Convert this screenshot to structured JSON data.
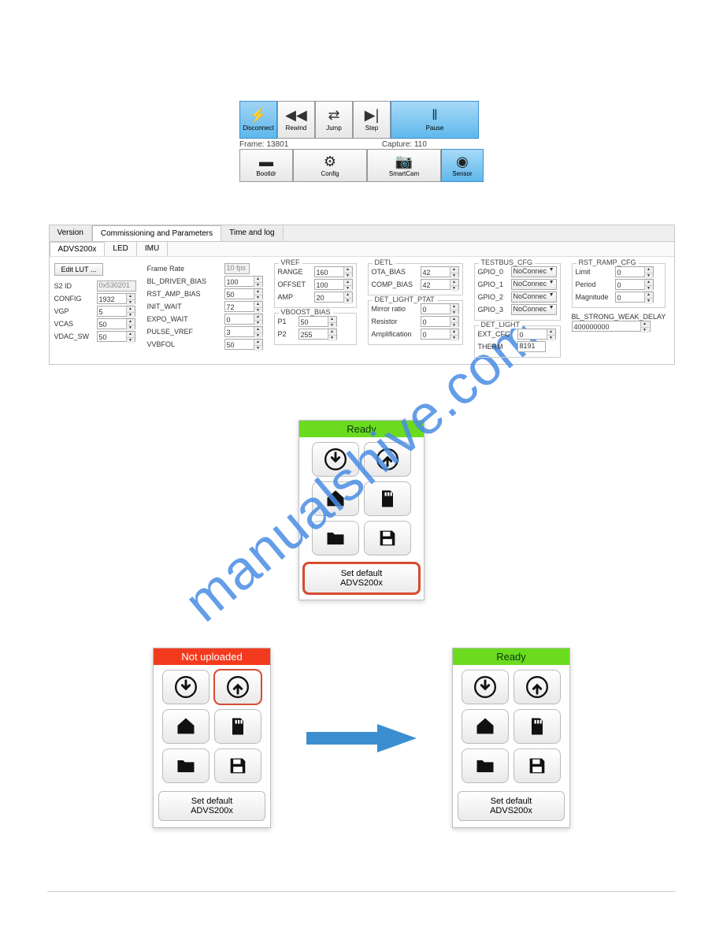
{
  "watermark": "manualshive.com",
  "toolbar": {
    "disconnect": "Disconnect",
    "rewind": "Rewind",
    "jump": "Jump",
    "step": "Step",
    "pause": "Pause",
    "bootldr": "Bootldr",
    "config": "Config",
    "smartcam": "SmartCam",
    "sensor": "Sensor"
  },
  "status": {
    "frame_label": "Frame:",
    "frame_value": "13801",
    "capture_label": "Capture:",
    "capture_value": "110"
  },
  "tabs": {
    "version": "Version",
    "commissioning": "Commissioning and Parameters",
    "timelog": "Time and log"
  },
  "subtabs": {
    "advs": "ADVS200x",
    "led": "LED",
    "imu": "IMU"
  },
  "params": {
    "edit_lut": "Edit LUT ...",
    "c1": {
      "s2id": {
        "label": "S2 ID",
        "value": "0x530201"
      },
      "config": {
        "label": "CONFIG",
        "value": "1932"
      },
      "vgp": {
        "label": "VGP",
        "value": "5"
      },
      "vcas": {
        "label": "VCAS",
        "value": "50"
      },
      "vdac": {
        "label": "VDAC_SW",
        "value": "50"
      }
    },
    "c2": {
      "frame_rate": {
        "label": "Frame Rate",
        "value": "10 fps"
      },
      "bl_driver": {
        "label": "BL_DRIVER_BIAS",
        "value": "100"
      },
      "rst_amp": {
        "label": "RST_AMP_BIAS",
        "value": "50"
      },
      "init_wait": {
        "label": "INIT_WAIT",
        "value": "72"
      },
      "expo_wait": {
        "label": "EXPO_WAIT",
        "value": "0"
      },
      "pulse_vref": {
        "label": "PULSE_VREF",
        "value": "3"
      },
      "vvbfol": {
        "label": "VVBFOL",
        "value": "50"
      }
    },
    "vref": {
      "title": "VREF",
      "range": {
        "label": "RANGE",
        "value": "160"
      },
      "offset": {
        "label": "OFFSET",
        "value": "100"
      },
      "amp": {
        "label": "AMP",
        "value": "20"
      }
    },
    "vboost": {
      "title": "VBOOST_BIAS",
      "p1": {
        "label": "P1",
        "value": "50"
      },
      "p2": {
        "label": "P2",
        "value": "255"
      }
    },
    "detl": {
      "title": "DETL",
      "ota": {
        "label": "OTA_BIAS",
        "value": "42"
      },
      "comp": {
        "label": "COMP_BIAS",
        "value": "42"
      }
    },
    "ptat": {
      "title": "DET_LIGHT_PTAT",
      "mirror": {
        "label": "Mirror ratio",
        "value": "0"
      },
      "resistor": {
        "label": "Resistor",
        "value": "0"
      },
      "amp": {
        "label": "Amplification",
        "value": "0"
      }
    },
    "testbus": {
      "title": "TESTBUS_CFG",
      "g0": {
        "label": "GPIO_0",
        "value": "NoConnec"
      },
      "g1": {
        "label": "GPIO_1",
        "value": "NoConnec"
      },
      "g2": {
        "label": "GPIO_2",
        "value": "NoConnec"
      },
      "g3": {
        "label": "GPIO_3",
        "value": "NoConnec"
      }
    },
    "detlight": {
      "title": "DET_LIGHT",
      "ext": {
        "label": "EXT_CFG",
        "value": "0"
      },
      "therm": {
        "label": "THERM",
        "value": "8191"
      }
    },
    "rstramp": {
      "title": "RST_RAMP_CFG",
      "limit": {
        "label": "Limit",
        "value": "0"
      },
      "period": {
        "label": "Period",
        "value": "0"
      },
      "magnitude": {
        "label": "Magnitude",
        "value": "0"
      }
    },
    "strongweak": {
      "label": "BL_STRONG_WEAK_DELAY",
      "value": "400000000"
    }
  },
  "panels": {
    "ready": "Ready",
    "not_uploaded": "Not uploaded",
    "set_default_line1": "Set default",
    "set_default_line2": "ADVS200x"
  }
}
